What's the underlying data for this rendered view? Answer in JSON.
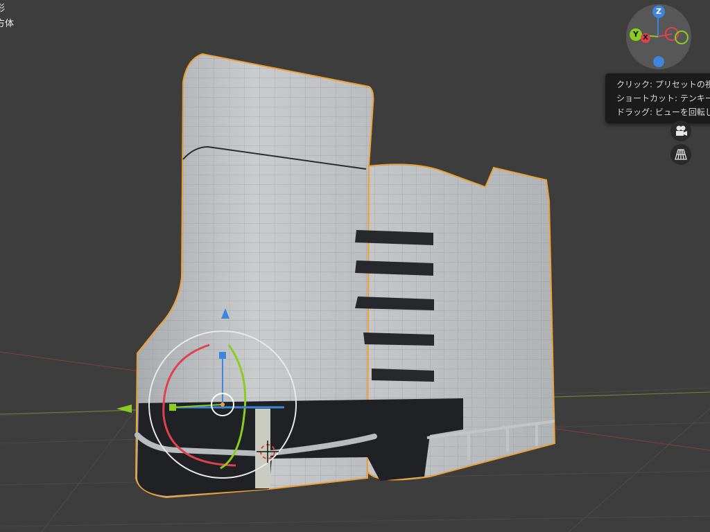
{
  "overlay": {
    "line1": "形",
    "line2": "方体"
  },
  "nav_gizmo": {
    "axis_z": "Z",
    "axis_y": "Y",
    "axis_x": "X",
    "colors": {
      "x": "#e0414f",
      "y": "#8bcd1f",
      "z": "#3d86dc"
    }
  },
  "tooltip": {
    "line1": "クリック: プリセットの視",
    "line2": "ショートカット: テンキー",
    "line3": "ドラッグ: ビューを回転し"
  },
  "side_buttons": {
    "camera_icon": "camera-icon",
    "grid_icon": "perspective-grid-icon"
  },
  "scene": {
    "object": "building-mesh",
    "selection_color": "#f0a030"
  }
}
